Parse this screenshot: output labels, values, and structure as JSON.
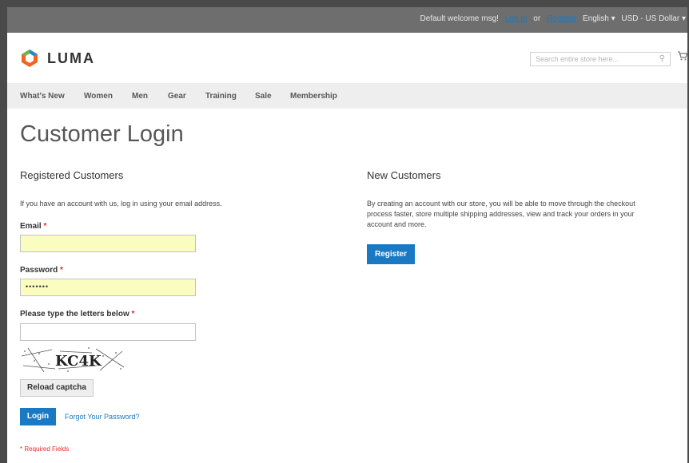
{
  "topbar": {
    "welcome": "Default welcome msg!",
    "login": "Log In",
    "or": "or",
    "register": "Register",
    "language": "English ▾",
    "currency": "USD - US Dollar ▾"
  },
  "header": {
    "logo_text": "LUMA",
    "search_placeholder": "Search entire store here...",
    "icons": {
      "search": "search-icon",
      "cart": "cart-icon"
    }
  },
  "nav": {
    "items": [
      "What's New",
      "Women",
      "Men",
      "Gear",
      "Training",
      "Sale",
      "Membership"
    ]
  },
  "page": {
    "title": "Customer Login"
  },
  "registered": {
    "heading": "Registered Customers",
    "intro": "If you have an account with us, log in using your email address.",
    "email_label": "Email",
    "password_label": "Password",
    "password_value": "•••••••",
    "captcha_label": "Please type the letters below",
    "captcha_text": "KC4K",
    "reload_button": "Reload captcha",
    "login_button": "Login",
    "forgot_link": "Forgot Your Password?",
    "required_note": "* Required Fields",
    "required_mark": "*"
  },
  "new_customers": {
    "heading": "New Customers",
    "text_line1": "By creating an account with our store, you will be able to move through the checkout",
    "text_line2": "process faster, store multiple shipping addresses, view and track your orders in your",
    "text_line3": "account and more.",
    "register_button": "Register"
  },
  "colors": {
    "accent": "#1979c3",
    "required": "#e02b27",
    "autofill": "#fafcc0",
    "logo_orange": "#f26322"
  }
}
